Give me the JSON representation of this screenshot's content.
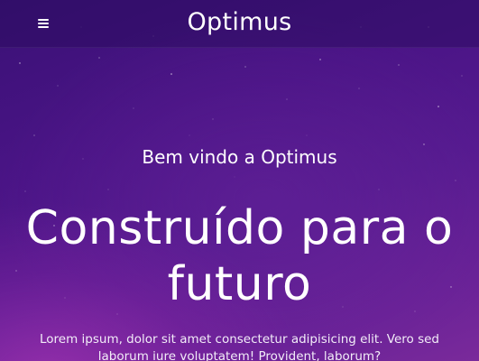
{
  "navbar": {
    "brand": "Optimus",
    "menu_icon": "hamburger-menu-icon"
  },
  "hero": {
    "welcome": "Bem vindo a Optimus",
    "headline": "Construído para o futuro",
    "description": "Lorem ipsum, dolor sit amet consectetur adipisicing elit. Vero sed laborum iure voluptatem! Provident, laborum?"
  },
  "colors": {
    "background_top": "#3a1176",
    "background_bottom": "#7a2a9b",
    "text": "#ffffff"
  }
}
